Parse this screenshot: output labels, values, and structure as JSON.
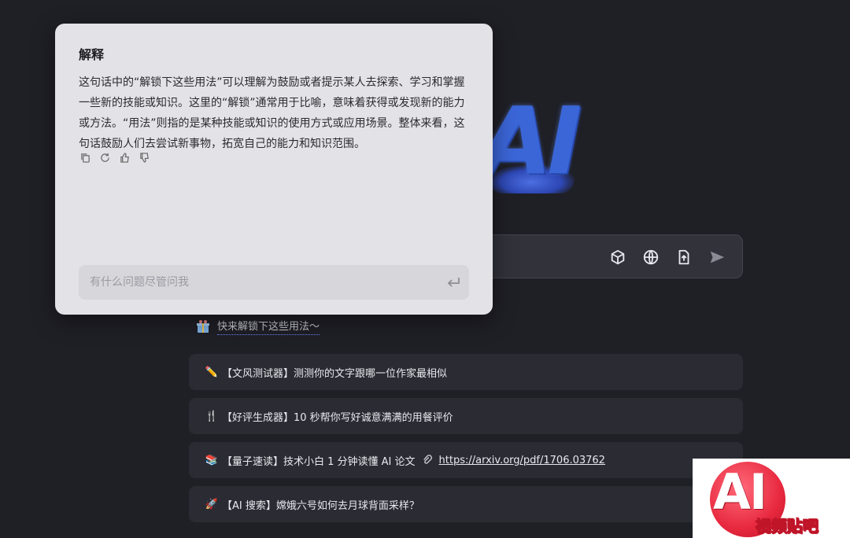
{
  "background_logo": {
    "text": "AI"
  },
  "popup": {
    "title": "解释",
    "body": "这句话中的“解锁下这些用法”可以理解为鼓励或者提示某人去探索、学习和掌握一些新的技能或知识。这里的“解锁”通常用于比喻，意味着获得或发现新的能力或方法。“用法”则指的是某种技能或知识的使用方式或应用场景。整体来看，这句话鼓励人们去尝试新事物，拓宽自己的能力和知识范围。",
    "actions": [
      "copy-icon",
      "regenerate-icon",
      "thumbs-up-icon",
      "thumbs-down-icon"
    ],
    "input_placeholder": "有什么问题尽管问我"
  },
  "input_bar": {
    "icons": [
      "cube-icon",
      "globe-icon",
      "file-upload-icon",
      "send-icon"
    ]
  },
  "hint": {
    "text": "快来解锁下这些用法～"
  },
  "suggestions": [
    {
      "emoji": "✏️",
      "text": "【文风测试器】测测你的文字跟哪一位作家最相似"
    },
    {
      "emoji": "🍴",
      "text": "【好评生成器】10 秒帮你写好诚意满满的用餐评价"
    },
    {
      "emoji": "📚",
      "text": "【量子速读】技术小白 1 分钟读懂 AI 论文",
      "link": "https://arxiv.org/pdf/1706.03762"
    },
    {
      "emoji": "🚀",
      "text": "【AI 搜索】嫦娥六号如何去月球背面采样？"
    }
  ],
  "watermark": {
    "ai": "AI",
    "label": "视频贴吧"
  },
  "colors": {
    "background": "#1f1f26",
    "popup": "#e3e3e7",
    "card": "#2b2b33",
    "accent": "#3b66d8",
    "watermark_red": "#e8293f"
  }
}
